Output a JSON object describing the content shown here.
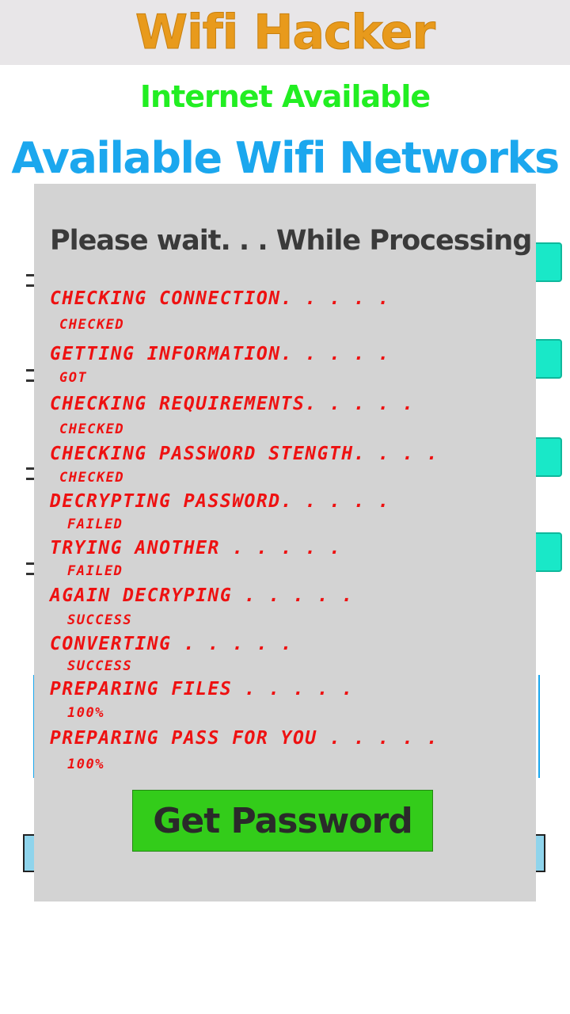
{
  "header": {
    "title": "Wifi Hacker"
  },
  "status": {
    "internet": "Internet Available"
  },
  "networks": {
    "heading": "Available Wifi Networks"
  },
  "dialog": {
    "title": "Please wait. . . While Processing",
    "steps": [
      {
        "label": "Checking connection. . . . .",
        "status": "checked"
      },
      {
        "label": "Getting information. . . . .",
        "status": "got"
      },
      {
        "label": "Checking requirements. . . . .",
        "status": "checked"
      },
      {
        "label": "Checking password stength. . . .",
        "status": "checked"
      },
      {
        "label": "Decrypting password. . . . .",
        "status": "failed"
      },
      {
        "label": "Trying another . . . . .",
        "status": "failed"
      },
      {
        "label": "Again decryping . . . . .",
        "status": "success"
      },
      {
        "label": "Converting . . . . .",
        "status": "success"
      },
      {
        "label": "Preparing files . . . . .",
        "status": "100%"
      },
      {
        "label": "Preparing pass for you . . . . .",
        "status": "100%"
      }
    ],
    "button_label": "Get Password"
  },
  "colors": {
    "title": "#e89a1c",
    "internet": "#22ee22",
    "heading": "#1ba7ee",
    "dialog_bg": "#d3d3d3",
    "step_text": "#ee1111",
    "button": "#33cc1a"
  }
}
